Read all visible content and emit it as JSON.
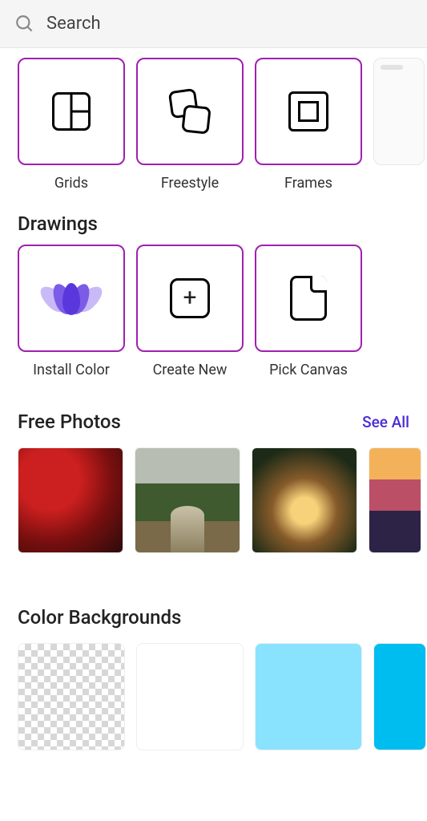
{
  "search": {
    "placeholder": "Search"
  },
  "top_row": {
    "items": [
      {
        "label": "Grids",
        "icon": "grids-icon"
      },
      {
        "label": "Freestyle",
        "icon": "freestyle-icon"
      },
      {
        "label": "Frames",
        "icon": "frames-icon"
      }
    ]
  },
  "drawings": {
    "title": "Drawings",
    "items": [
      {
        "label": "Install Color",
        "icon": "lotus-icon"
      },
      {
        "label": "Create New",
        "icon": "plus-box-icon"
      },
      {
        "label": "Pick Canvas",
        "icon": "canvas-icon"
      }
    ]
  },
  "free_photos": {
    "title": "Free Photos",
    "see_all": "See All",
    "items": [
      "flowers",
      "forest",
      "candle",
      "sunset"
    ]
  },
  "color_backgrounds": {
    "title": "Color Backgrounds",
    "items": [
      "transparent",
      "white",
      "light-blue",
      "cyan"
    ]
  }
}
